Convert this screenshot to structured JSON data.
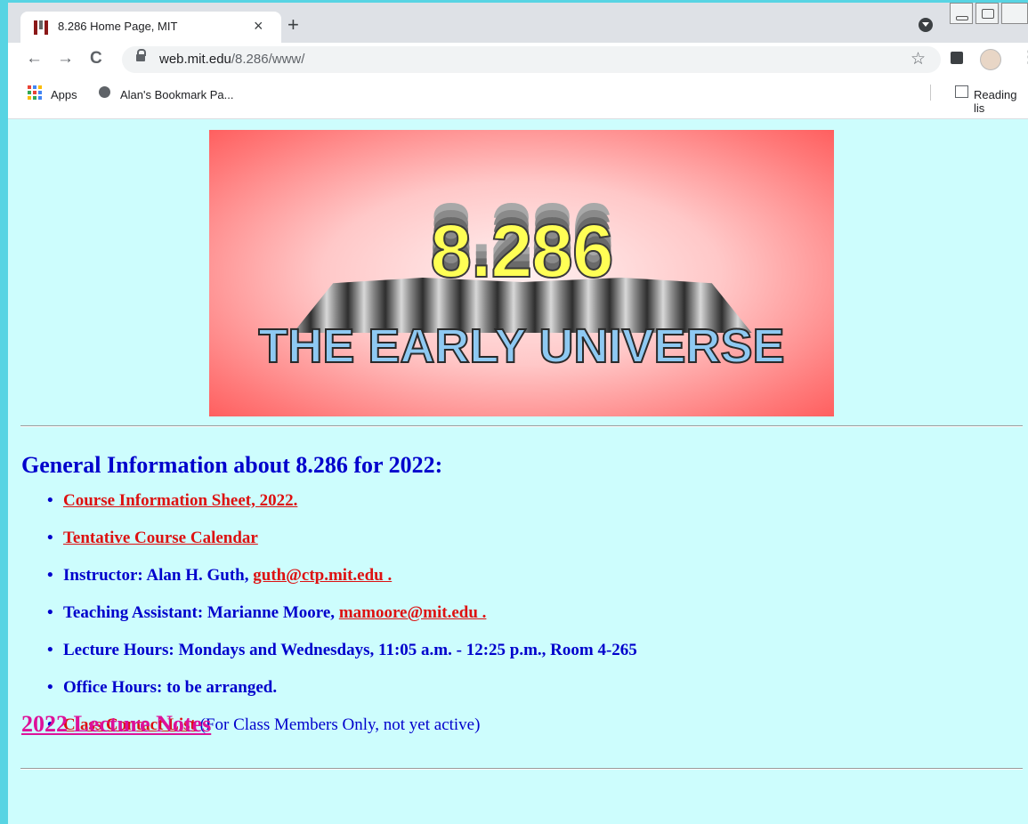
{
  "browser": {
    "tab_title": "8.286 Home Page, MIT",
    "tab_close": "×",
    "new_tab": "+",
    "back": "←",
    "forward": "→",
    "reload": "C",
    "url_host": "web.mit.edu",
    "url_path": "/8.286/www/",
    "star": "☆",
    "menu": "⋮"
  },
  "bookmarks": {
    "apps": "Apps",
    "item1": "Alan's Bookmark Pa...",
    "reading_list": "Reading lis"
  },
  "banner": {
    "number": "8.286",
    "subtitle": "THE EARLY UNIVERSE",
    "colors": {
      "number_fill": "#ffff55",
      "subtitle_fill": "#8ec9f2",
      "edge": "#ff5f5f",
      "center": "#fff0f0"
    }
  },
  "section": {
    "heading": "General Information about 8.286 for 2022:",
    "items": [
      {
        "link": "Course Information Sheet, 2022."
      },
      {
        "link": "Tentative Course Calendar"
      },
      {
        "prefix": "Instructor: Alan H. Guth, ",
        "link": "guth@ctp.mit.edu ."
      },
      {
        "prefix": "Teaching Assistant: Marianne Moore, ",
        "link": "mamoore@mit.edu ."
      },
      {
        "text": "Lecture Hours: Mondays and Wednesdays, 11:05 a.m. - 12:25 p.m., Room 4-265"
      },
      {
        "text": "Office Hours: to be arranged."
      },
      {
        "link": "Class Contact List",
        "suffix": " (For Class Members Only, not yet active)"
      }
    ]
  },
  "lecture_notes": "2022 Lecture Notes",
  "colors": {
    "page_bg": "#cdfdfd",
    "heading": "#0000cc",
    "link": "#dd1111",
    "notes_link": "#dd1199"
  }
}
